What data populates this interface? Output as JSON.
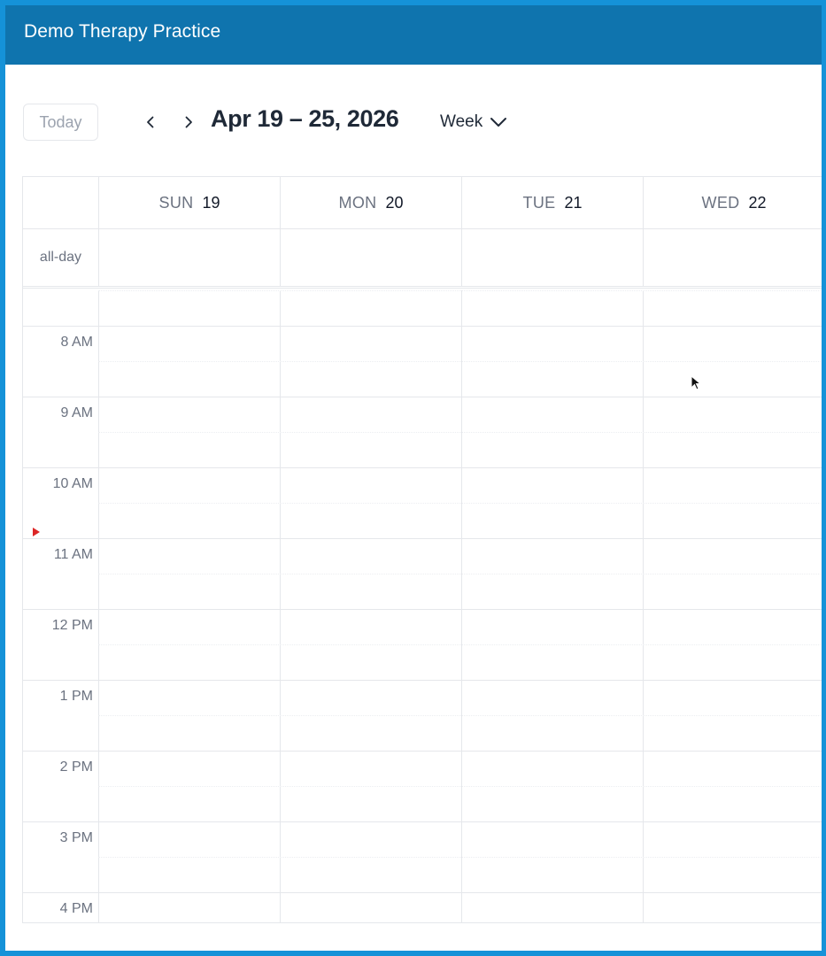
{
  "app": {
    "title": "Demo Therapy Practice"
  },
  "toolbar": {
    "today_label": "Today",
    "range_title": "Apr 19 – 25, 2026",
    "view_label": "Week"
  },
  "calendar": {
    "days": [
      {
        "name": "SUN",
        "num": "19"
      },
      {
        "name": "MON",
        "num": "20"
      },
      {
        "name": "TUE",
        "num": "21"
      },
      {
        "name": "WED",
        "num": "22"
      }
    ],
    "allday_label": "all-day",
    "hours": [
      "8 AM",
      "9 AM",
      "10 AM",
      "11 AM",
      "12 PM",
      "1 PM",
      "2 PM",
      "3 PM",
      "4 PM"
    ]
  },
  "colors": {
    "header": "#0f74ae",
    "frame": "#1592d8",
    "now_indicator": "#dc2626"
  }
}
